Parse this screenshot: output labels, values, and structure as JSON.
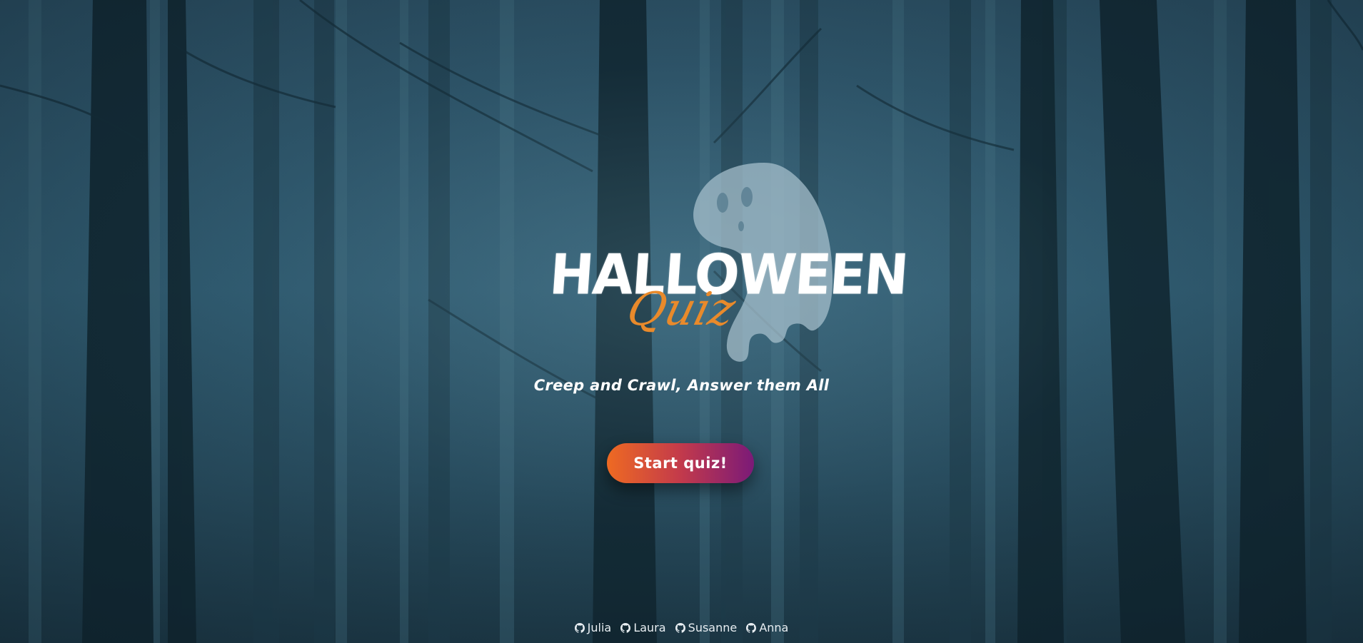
{
  "logo": {
    "title": "HALLOWEEN",
    "subtitle": "Quiz",
    "ghost_icon": "ghost-icon",
    "accent_color": "#e98a2b"
  },
  "tagline": "Creep and Crawl, Answer them All",
  "start_button": {
    "label": "Start quiz!",
    "gradient": [
      "#ee6a22",
      "#c33a4b",
      "#7b1a78"
    ]
  },
  "credits": [
    {
      "icon": "github-icon",
      "name": "Julia"
    },
    {
      "icon": "github-icon",
      "name": "Laura"
    },
    {
      "icon": "github-icon",
      "name": "Susanne"
    },
    {
      "icon": "github-icon",
      "name": "Anna"
    }
  ],
  "background": {
    "description_icon": "forest-background",
    "base_color": "#2b4f63"
  }
}
